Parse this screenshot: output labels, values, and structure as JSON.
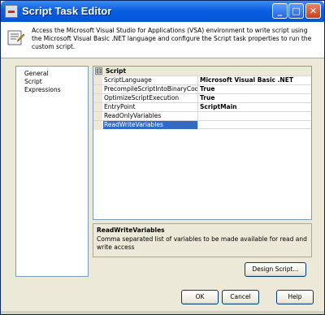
{
  "window": {
    "title": "Script Task Editor",
    "controls": {
      "minimize": "_",
      "maximize": "□",
      "close": "✕"
    },
    "colors": {
      "titlebar": "#0a5fe4",
      "selection": "#316ac5",
      "face": "#ece9d8"
    }
  },
  "header": {
    "icon": "script-task-icon",
    "description": "Access the Microsoft Visual Studio for Applications (VSA) environment to write script using the Microsoft Visual Basic .NET language and configure the Script task properties to run the custom script."
  },
  "nav": {
    "items": [
      {
        "label": "General"
      },
      {
        "label": "Script"
      },
      {
        "label": "Expressions"
      }
    ]
  },
  "grid": {
    "category": {
      "expander": "⊟",
      "label": "Script"
    },
    "rows": [
      {
        "name": "ScriptLanguage",
        "value": "Microsoft Visual Basic .NET"
      },
      {
        "name": "PrecompileScriptIntoBinaryCode",
        "value": "True"
      },
      {
        "name": "OptimizeScriptExecution",
        "value": "True"
      },
      {
        "name": "EntryPoint",
        "value": "ScriptMain"
      },
      {
        "name": "ReadOnlyVariables",
        "value": ""
      },
      {
        "name": "ReadWriteVariables",
        "value": "",
        "selected": true
      }
    ]
  },
  "description": {
    "title": "ReadWriteVariables",
    "text": "Comma separated list of variables to be made available for read and write access"
  },
  "buttons": {
    "design_script": "Design Script...",
    "ok": "OK",
    "cancel": "Cancel",
    "help": "Help"
  }
}
